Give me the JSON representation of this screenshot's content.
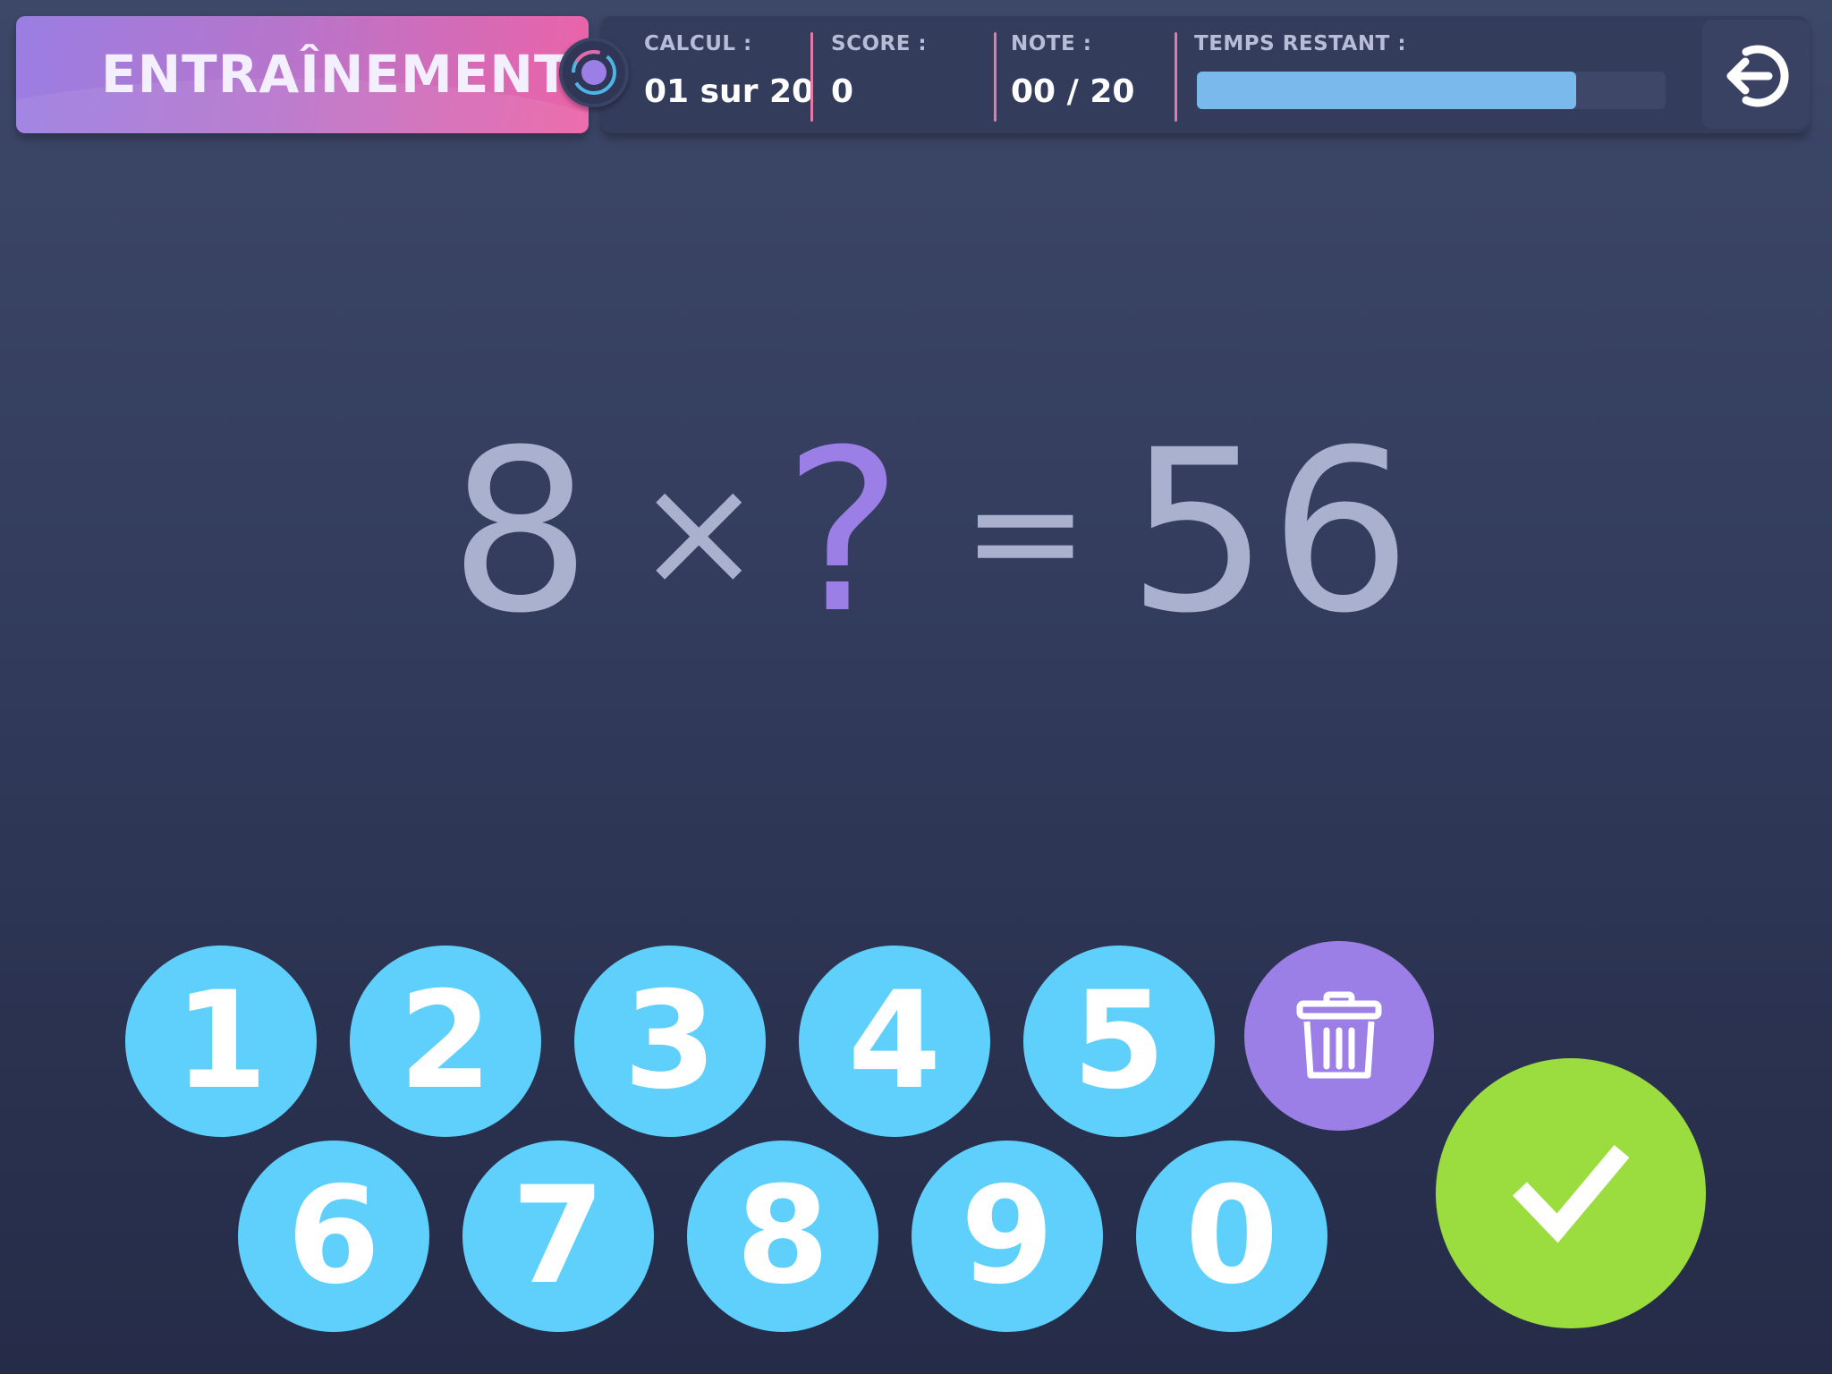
{
  "header": {
    "mode_title": "ENTRAÎNEMENT",
    "stats": [
      {
        "label": "CALCUL :",
        "value": "01 sur 20"
      },
      {
        "label": "SCORE :",
        "value": "0"
      },
      {
        "label": "NOTE :",
        "value": "00 / 20"
      }
    ],
    "timer": {
      "label": "TEMPS RESTANT :",
      "remaining_fraction": 0.81
    },
    "exit_icon": "exit-icon",
    "badge_icon": "level-badge-icon"
  },
  "equation": {
    "left_operand": "8",
    "operator": "×",
    "unknown": "?",
    "equals": "=",
    "result": "56"
  },
  "keypad": {
    "row1": [
      "1",
      "2",
      "3",
      "4",
      "5"
    ],
    "row2": [
      "6",
      "7",
      "8",
      "9",
      "0"
    ],
    "delete_icon": "trash-icon",
    "validate_icon": "checkmark-icon"
  },
  "colors": {
    "key": "#5ed0fb",
    "delete": "#9b7fe6",
    "validate": "#9bdc3e",
    "unknown": "#9b7fe6",
    "timer_fill": "#79b9ec",
    "divider": "#e37aa8"
  }
}
